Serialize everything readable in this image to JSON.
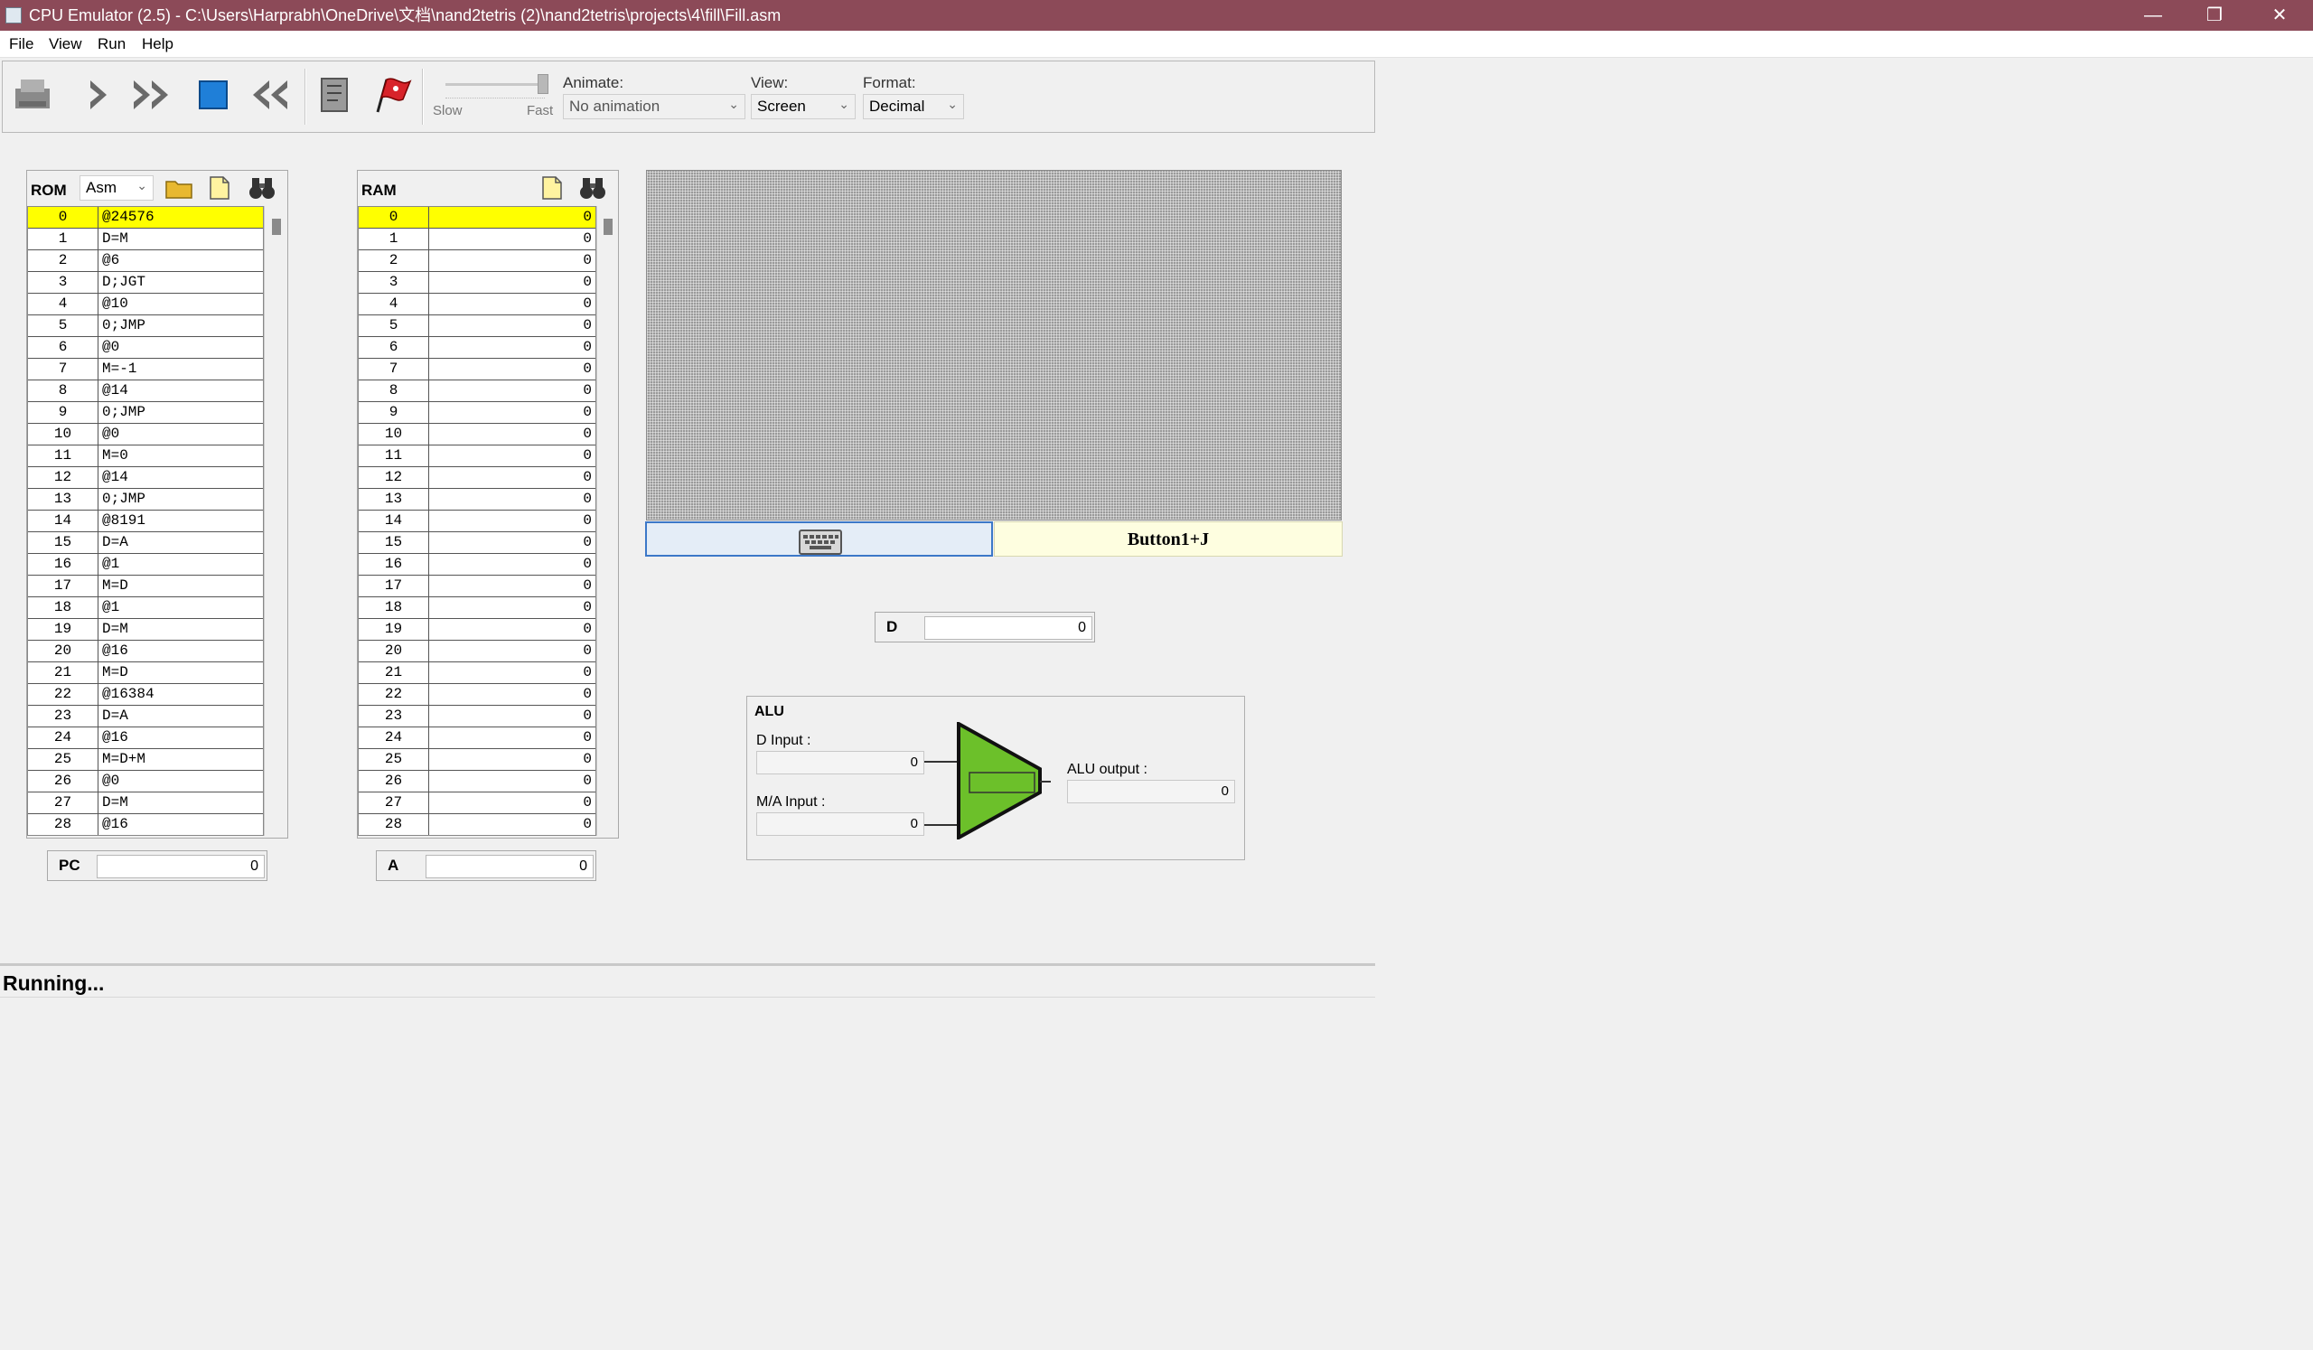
{
  "window": {
    "title": "CPU Emulator (2.5) - C:\\Users\\Harprabh\\OneDrive\\文档\\nand2tetris (2)\\nand2tetris\\projects\\4\\fill\\Fill.asm",
    "minimize": "—",
    "restore": "❐",
    "close": "✕"
  },
  "menu": [
    "File",
    "View",
    "Run",
    "Help"
  ],
  "toolbar": {
    "slider_slow": "Slow",
    "slider_fast": "Fast",
    "animate_label": "Animate:",
    "animate_value": "No animation",
    "view_label": "View:",
    "view_value": "Screen",
    "format_label": "Format:",
    "format_value": "Decimal"
  },
  "rom": {
    "title": "ROM",
    "mode": "Asm",
    "rows": [
      [
        "0",
        "@24576"
      ],
      [
        "1",
        "D=M"
      ],
      [
        "2",
        "@6"
      ],
      [
        "3",
        "D;JGT"
      ],
      [
        "4",
        "@10"
      ],
      [
        "5",
        "0;JMP"
      ],
      [
        "6",
        "@0"
      ],
      [
        "7",
        "M=-1"
      ],
      [
        "8",
        "@14"
      ],
      [
        "9",
        "0;JMP"
      ],
      [
        "10",
        "@0"
      ],
      [
        "11",
        "M=0"
      ],
      [
        "12",
        "@14"
      ],
      [
        "13",
        "0;JMP"
      ],
      [
        "14",
        "@8191"
      ],
      [
        "15",
        "D=A"
      ],
      [
        "16",
        "@1"
      ],
      [
        "17",
        "M=D"
      ],
      [
        "18",
        "@1"
      ],
      [
        "19",
        "D=M"
      ],
      [
        "20",
        "@16"
      ],
      [
        "21",
        "M=D"
      ],
      [
        "22",
        "@16384"
      ],
      [
        "23",
        "D=A"
      ],
      [
        "24",
        "@16"
      ],
      [
        "25",
        "M=D+M"
      ],
      [
        "26",
        "@0"
      ],
      [
        "27",
        "D=M"
      ],
      [
        "28",
        "@16"
      ]
    ]
  },
  "ram": {
    "title": "RAM",
    "rows": [
      [
        "0",
        "0"
      ],
      [
        "1",
        "0"
      ],
      [
        "2",
        "0"
      ],
      [
        "3",
        "0"
      ],
      [
        "4",
        "0"
      ],
      [
        "5",
        "0"
      ],
      [
        "6",
        "0"
      ],
      [
        "7",
        "0"
      ],
      [
        "8",
        "0"
      ],
      [
        "9",
        "0"
      ],
      [
        "10",
        "0"
      ],
      [
        "11",
        "0"
      ],
      [
        "12",
        "0"
      ],
      [
        "13",
        "0"
      ],
      [
        "14",
        "0"
      ],
      [
        "15",
        "0"
      ],
      [
        "16",
        "0"
      ],
      [
        "17",
        "0"
      ],
      [
        "18",
        "0"
      ],
      [
        "19",
        "0"
      ],
      [
        "20",
        "0"
      ],
      [
        "21",
        "0"
      ],
      [
        "22",
        "0"
      ],
      [
        "23",
        "0"
      ],
      [
        "24",
        "0"
      ],
      [
        "25",
        "0"
      ],
      [
        "26",
        "0"
      ],
      [
        "27",
        "0"
      ],
      [
        "28",
        "0"
      ]
    ]
  },
  "registers": {
    "pc_label": "PC",
    "pc_value": "0",
    "a_label": "A",
    "a_value": "0",
    "d_label": "D",
    "d_value": "0"
  },
  "keyboard": {
    "text": "Button1+J"
  },
  "alu": {
    "title": "ALU",
    "d_input_label": "D Input :",
    "d_input_value": "0",
    "ma_input_label": "M/A Input :",
    "ma_input_value": "0",
    "output_label": "ALU output :",
    "output_value": "0"
  },
  "status": "Running...",
  "colors": {
    "titlebar": "#8c4a58",
    "highlight": "#ffff00",
    "alu_green": "#6cc02a"
  }
}
